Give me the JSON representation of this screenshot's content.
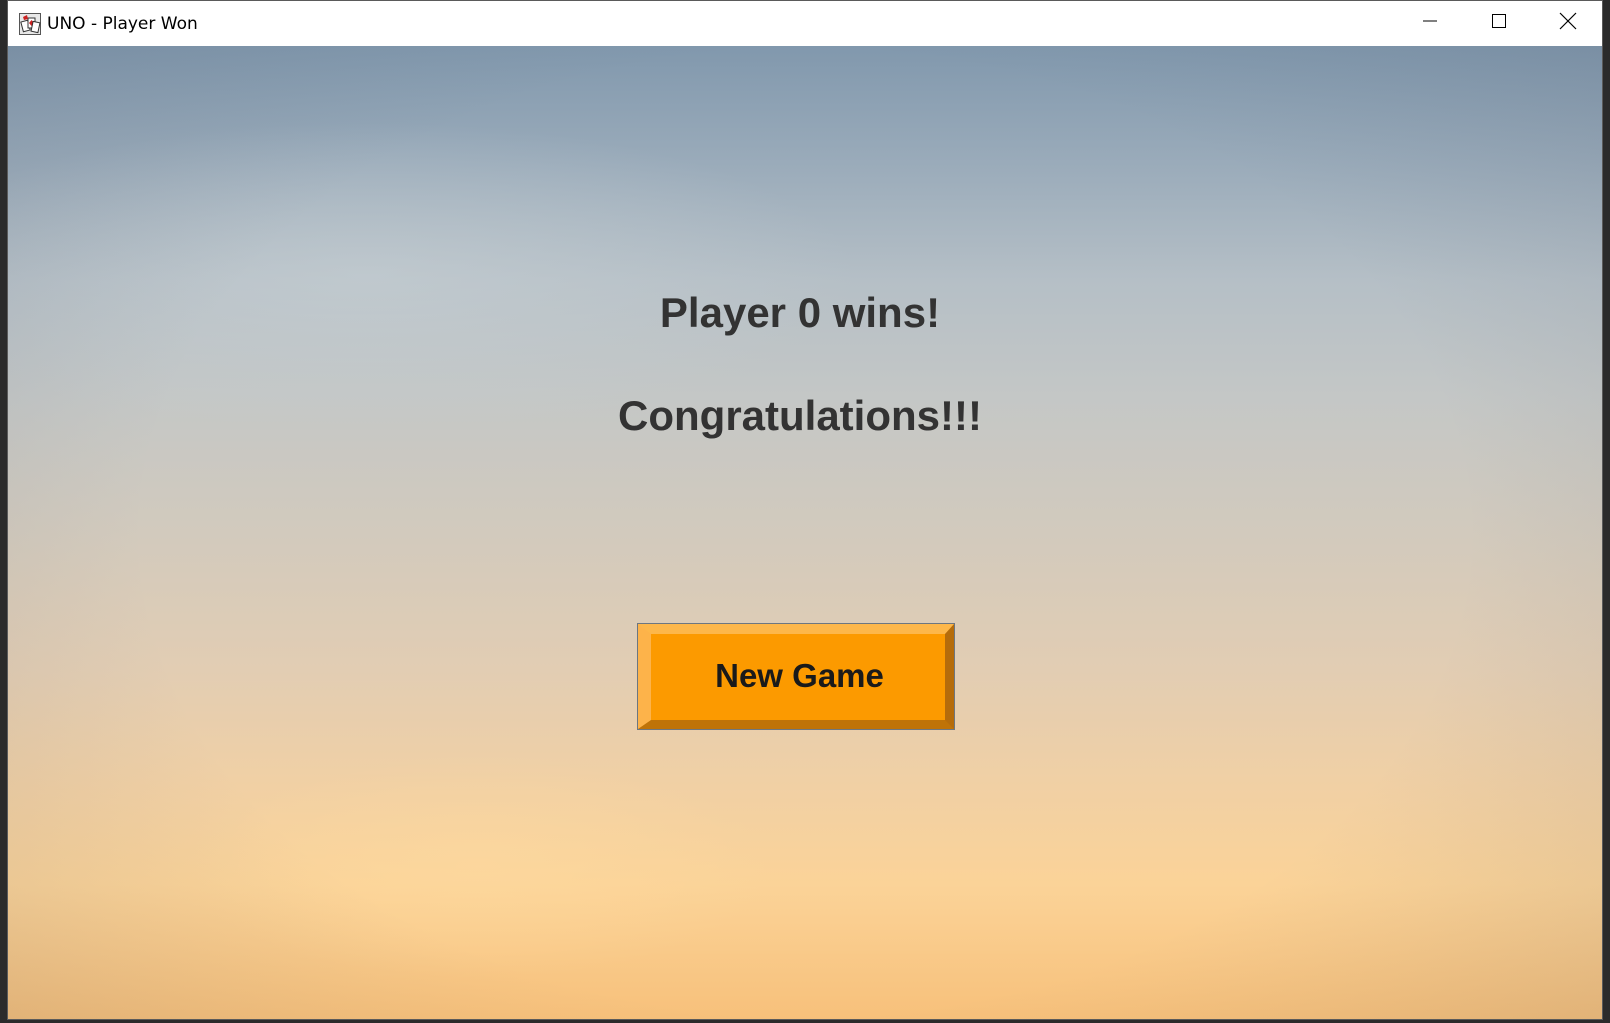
{
  "window": {
    "title": "UNO - Player Won",
    "app_icon": "uno-app-icon",
    "controls": {
      "minimize_icon": "minimize-icon",
      "maximize_icon": "maximize-icon",
      "close_icon": "close-icon"
    }
  },
  "main": {
    "winner_message": "Player 0 wins!",
    "congrats_message": "Congratulations!!!",
    "new_game_label": "New Game"
  },
  "colors": {
    "button_fill": "#fc9a00",
    "text": "#333333",
    "sky_top": "#8198ad",
    "sky_bottom": "#f7c07a"
  }
}
